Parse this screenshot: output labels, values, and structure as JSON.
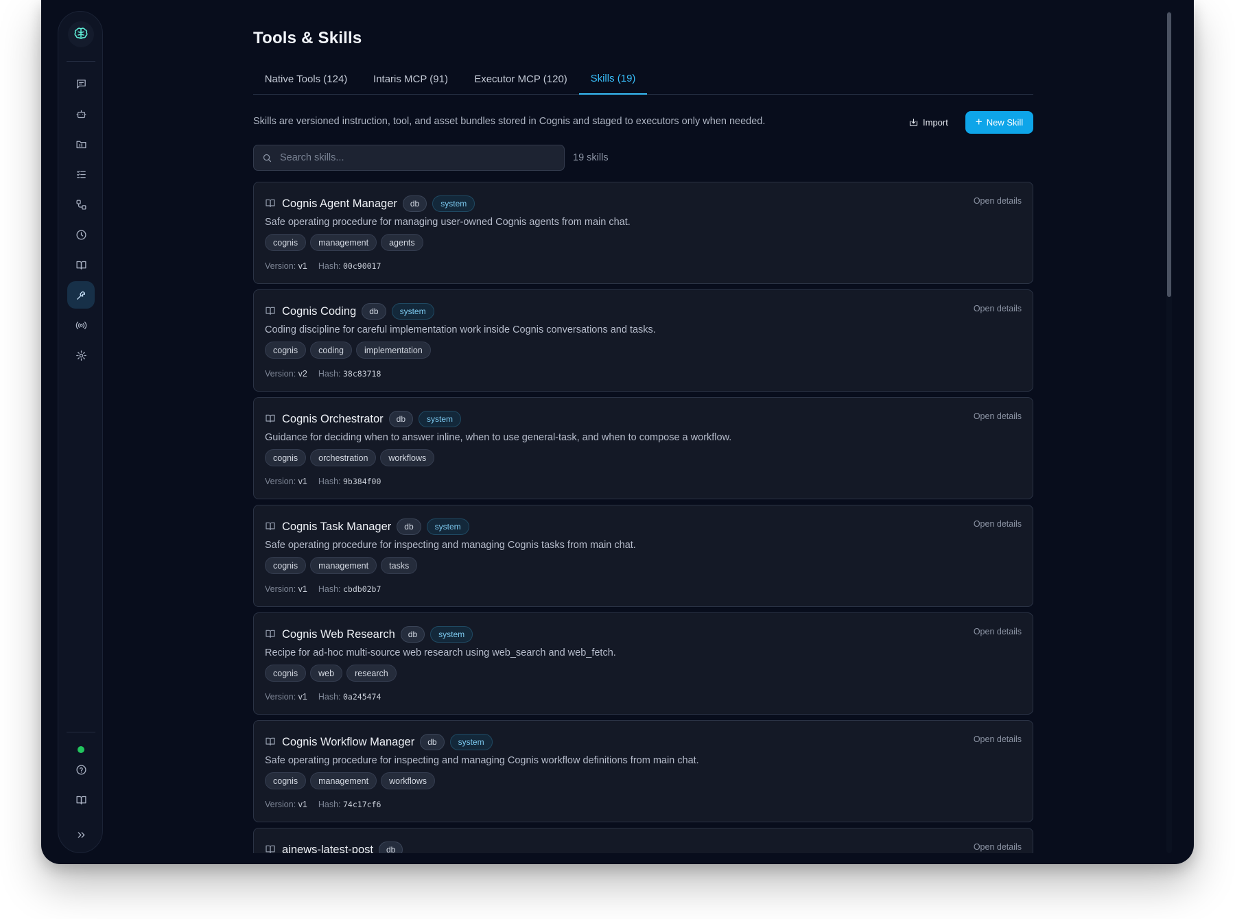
{
  "page": {
    "title": "Tools & Skills",
    "description": "Skills are versioned instruction, tool, and asset bundles stored in Cognis and staged to executors only when needed.",
    "import_label": "Import",
    "new_skill_label": "New Skill",
    "search_placeholder": "Search skills...",
    "count_label": "19 skills",
    "accent_color": "#0ea5e9"
  },
  "tabs": [
    {
      "label": "Native Tools (124)",
      "active": false
    },
    {
      "label": "Intaris MCP (91)",
      "active": false
    },
    {
      "label": "Executor MCP (120)",
      "active": false
    },
    {
      "label": "Skills (19)",
      "active": true
    }
  ],
  "sidebar": {
    "items": [
      "chat-icon",
      "bot-icon",
      "folder-icon",
      "list-checks-icon",
      "workflow-icon",
      "clock-icon",
      "book-icon",
      "wrench-icon",
      "radio-icon",
      "gear-icon"
    ],
    "active_item": "wrench-icon",
    "bottom": [
      "status-dot",
      "help-icon",
      "docs-book-icon",
      "expand-icon"
    ],
    "status_color": "#22c55e"
  },
  "labels": {
    "open_details": "Open details",
    "version": "Version:",
    "hash": "Hash:",
    "db": "db",
    "system": "system"
  },
  "skills": [
    {
      "name": "Cognis Agent Manager",
      "badges": [
        "db",
        "system"
      ],
      "description": "Safe operating procedure for managing user-owned Cognis agents from main chat.",
      "tags": [
        "cognis",
        "management",
        "agents"
      ],
      "version": "v1",
      "hash": "00c90017"
    },
    {
      "name": "Cognis Coding",
      "badges": [
        "db",
        "system"
      ],
      "description": "Coding discipline for careful implementation work inside Cognis conversations and tasks.",
      "tags": [
        "cognis",
        "coding",
        "implementation"
      ],
      "version": "v2",
      "hash": "38c83718"
    },
    {
      "name": "Cognis Orchestrator",
      "badges": [
        "db",
        "system"
      ],
      "description": "Guidance for deciding when to answer inline, when to use general-task, and when to compose a workflow.",
      "tags": [
        "cognis",
        "orchestration",
        "workflows"
      ],
      "version": "v1",
      "hash": "9b384f00"
    },
    {
      "name": "Cognis Task Manager",
      "badges": [
        "db",
        "system"
      ],
      "description": "Safe operating procedure for inspecting and managing Cognis tasks from main chat.",
      "tags": [
        "cognis",
        "management",
        "tasks"
      ],
      "version": "v1",
      "hash": "cbdb02b7"
    },
    {
      "name": "Cognis Web Research",
      "badges": [
        "db",
        "system"
      ],
      "description": "Recipe for ad-hoc multi-source web research using web_search and web_fetch.",
      "tags": [
        "cognis",
        "web",
        "research"
      ],
      "version": "v1",
      "hash": "0a245474"
    },
    {
      "name": "Cognis Workflow Manager",
      "badges": [
        "db",
        "system"
      ],
      "description": "Safe operating procedure for inspecting and managing Cognis workflow definitions from main chat.",
      "tags": [
        "cognis",
        "management",
        "workflows"
      ],
      "version": "v1",
      "hash": "74c17cf6"
    },
    {
      "name": "ainews-latest-post",
      "badges": [
        "db"
      ],
      "description": "",
      "tags": [],
      "version": "",
      "hash": ""
    }
  ]
}
